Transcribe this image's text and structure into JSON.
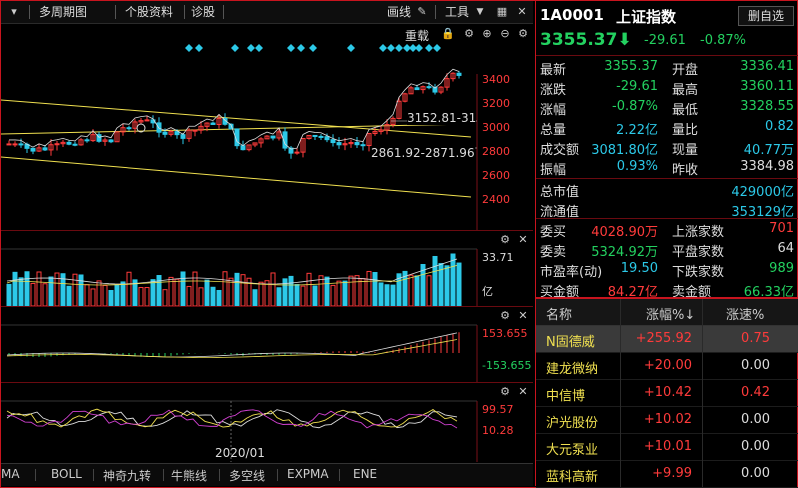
{
  "toolbar": {
    "multi_period": "多周期图",
    "stock_info": "个股资料",
    "diagnose": "诊股",
    "draw_line": "画线",
    "tools": "工具",
    "reload": "重载"
  },
  "main_chart": {
    "y_ticks": [
      "3400",
      "3200",
      "3000",
      "2800",
      "2600",
      "2400"
    ],
    "annot_high": "3152.81-31",
    "annot_low": "2861.92-2871.96",
    "date_label": "2020/01"
  },
  "volume_panel": {
    "top_value": "33.71",
    "unit": "亿"
  },
  "macd_panel": {
    "top_value": "153.655",
    "bottom_value": "-153.655"
  },
  "kdj_panel": {
    "top_value": "99.57",
    "bottom_value": "10.28"
  },
  "bottom_tabs": [
    "MA",
    "BOLL",
    "神奇九转",
    "牛熊线",
    "多空线",
    "EXPMA",
    "ENE"
  ],
  "quote": {
    "code": "1A0001",
    "name": "上证指数",
    "delete_label": "删自选",
    "price": "3355.37",
    "change": "-29.61",
    "change_pct": "-0.87%",
    "rows": [
      {
        "l1": "最新",
        "v1": "3355.37",
        "c1": "green",
        "l2": "开盘",
        "v2": "3336.41",
        "c2": "green"
      },
      {
        "l1": "涨跌",
        "v1": "-29.61",
        "c1": "green",
        "l2": "最高",
        "v2": "3360.11",
        "c2": "green"
      },
      {
        "l1": "涨幅",
        "v1": "-0.87%",
        "c1": "green",
        "l2": "最低",
        "v2": "3328.55",
        "c2": "green"
      },
      {
        "l1": "总量",
        "v1": "2.22亿",
        "c1": "cyan",
        "l2": "量比",
        "v2": "0.82",
        "c2": "cyan"
      },
      {
        "l1": "成交额",
        "v1": "3081.80亿",
        "c1": "cyan",
        "l2": "现量",
        "v2": "40.77万",
        "c2": "cyan"
      },
      {
        "l1": "振幅",
        "v1": "0.93%",
        "c1": "cyan",
        "l2": "昨收",
        "v2": "3384.98",
        "c2": "white"
      }
    ],
    "cap_rows": [
      {
        "l": "总市值",
        "v": "429000亿"
      },
      {
        "l": "流通值",
        "v": "353129亿"
      }
    ],
    "book_rows": [
      {
        "l1": "委买",
        "v1": "4028.90万",
        "c1": "red",
        "l2": "上涨家数",
        "v2": "701",
        "c2": "red"
      },
      {
        "l1": "委卖",
        "v1": "5324.92万",
        "c1": "green",
        "l2": "平盘家数",
        "v2": "64",
        "c2": "white"
      },
      {
        "l1": "市盈率(动)",
        "v1": "19.50",
        "c1": "cyan",
        "l2": "下跌家数",
        "v2": "989",
        "c2": "green"
      },
      {
        "l1": "买金额",
        "v1": "84.27亿",
        "c1": "red",
        "l2": "卖金额",
        "v2": "66.33亿",
        "c2": "green"
      }
    ]
  },
  "list": {
    "col_name": "名称",
    "col_pct": "涨幅%↓",
    "col_speed": "涨速%",
    "rows": [
      {
        "name": "N固德威",
        "pct": "+255.92",
        "speed": "0.75",
        "speed_color": "red",
        "selected": true
      },
      {
        "name": "建龙微纳",
        "pct": "+20.00",
        "speed": "0.00",
        "speed_color": "white",
        "selected": false
      },
      {
        "name": "中信博",
        "pct": "+10.42",
        "speed": "0.42",
        "speed_color": "red",
        "selected": false
      },
      {
        "name": "沪光股份",
        "pct": "+10.02",
        "speed": "0.00",
        "speed_color": "white",
        "selected": false
      },
      {
        "name": "大元泵业",
        "pct": "+10.01",
        "speed": "0.00",
        "speed_color": "white",
        "selected": false
      },
      {
        "name": "蓝科高新",
        "pct": "+9.99",
        "speed": "0.00",
        "speed_color": "white",
        "selected": false
      }
    ]
  },
  "colors": {
    "up": "#ff3b3b",
    "down": "#23d160",
    "cyan": "#2cc9e8",
    "yellow": "#f0e050",
    "border": "#c8141e"
  }
}
